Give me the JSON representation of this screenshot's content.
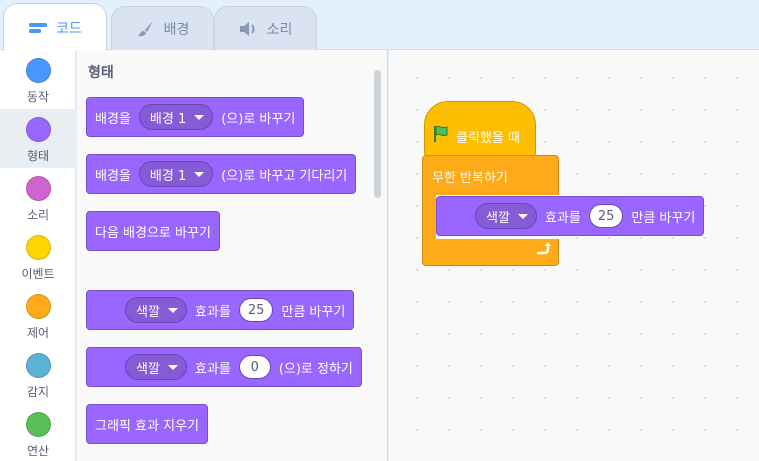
{
  "tabs": [
    {
      "label": "코드",
      "icon": "code-icon"
    },
    {
      "label": "배경",
      "icon": "brush-icon"
    },
    {
      "label": "소리",
      "icon": "speaker-icon"
    }
  ],
  "categories": [
    {
      "label": "동작",
      "color": "#4c97ff"
    },
    {
      "label": "형태",
      "color": "#9966ff"
    },
    {
      "label": "소리",
      "color": "#cf63cf"
    },
    {
      "label": "이벤트",
      "color": "#ffd500"
    },
    {
      "label": "제어",
      "color": "#ffab19"
    },
    {
      "label": "감지",
      "color": "#5cb1d6"
    },
    {
      "label": "연산",
      "color": "#59c059"
    }
  ],
  "palette": {
    "title": "형태",
    "blocks": [
      {
        "pre": "배경을",
        "dropdown": "배경 1",
        "post": "(으)로 바꾸기"
      },
      {
        "pre": "배경을",
        "dropdown": "배경 1",
        "post": "(으)로 바꾸고 기다리기"
      },
      {
        "text": "다음 배경으로 바꾸기"
      },
      {
        "dropdown": "색깔",
        "mid": "효과를",
        "value": "25",
        "post": "만큼 바꾸기"
      },
      {
        "dropdown": "색깔",
        "mid": "효과를",
        "value": "0",
        "post": "(으)로 정하기"
      },
      {
        "text": "그래픽 효과 지우기"
      }
    ]
  },
  "script": {
    "hat_label": "클릭했을 때",
    "forever_label": "무한 반복하기",
    "inner": {
      "dropdown": "색깔",
      "mid": "효과를",
      "value": "25",
      "post": "만큼 바꾸기"
    }
  }
}
